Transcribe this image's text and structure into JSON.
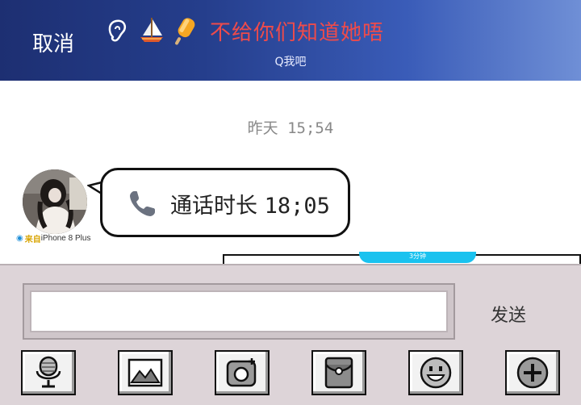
{
  "header": {
    "cancel_label": "取消",
    "title": "不给你们知道她唔",
    "subtitle": "Q我吧",
    "emojis": [
      "ear-icon",
      "sailboat-icon",
      "popsicle-icon"
    ]
  },
  "chat": {
    "timestamp": "昨天 15;54",
    "message": {
      "prefix": "通话时长",
      "duration": "18;05",
      "icon": "phone-icon"
    },
    "device": {
      "from_label": "来自",
      "model": "iPhone 8 Plus"
    },
    "next_badge": "3分钟"
  },
  "input": {
    "value": "",
    "placeholder": "",
    "send_label": "发送"
  },
  "toolbar": {
    "tools": [
      "microphone-icon",
      "image-icon",
      "camera-icon",
      "red-packet-icon",
      "emoji-icon",
      "plus-icon"
    ]
  },
  "colors": {
    "header_start": "#1d2f72",
    "header_end": "#6f8fd6",
    "title": "#ee4b4b",
    "badge": "#1ac2ef",
    "input_bg": "#ddd4d8"
  }
}
